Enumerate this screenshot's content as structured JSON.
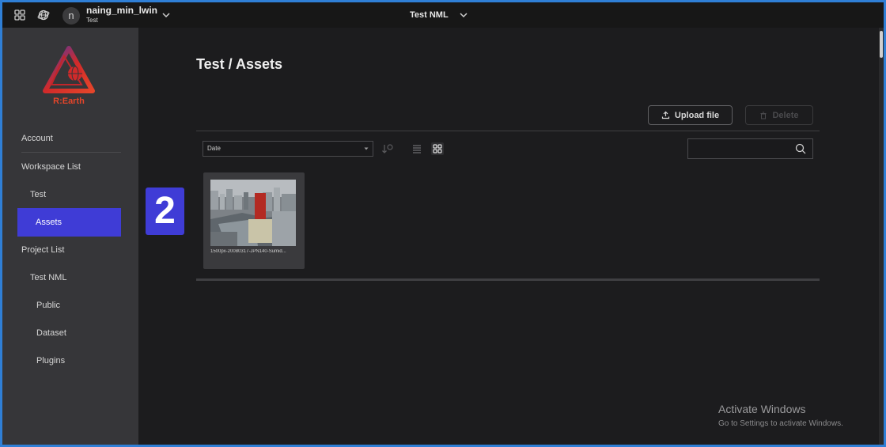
{
  "topbar": {
    "apps_icon": "apps-grid-icon",
    "globe_icon": "globe-icon",
    "avatar_initial": "n",
    "user_name": "naing_min_lwin",
    "workspace": "Test",
    "project_title": "Test NML"
  },
  "sidebar": {
    "logo_text": "R:Earth",
    "items": [
      {
        "label": "Account"
      },
      {
        "label": "Workspace List"
      },
      {
        "label": "Test"
      },
      {
        "label": "Assets"
      },
      {
        "label": "Project List"
      },
      {
        "label": "Test NML"
      },
      {
        "label": "Public"
      },
      {
        "label": "Dataset"
      },
      {
        "label": "Plugins"
      }
    ]
  },
  "main": {
    "title": "Test / Assets",
    "upload_label": "Upload file",
    "delete_label": "Delete",
    "sort_value": "Date",
    "search_placeholder": "",
    "assets": [
      {
        "name": "1500px-20080317-JPN140-Sumid..."
      }
    ],
    "badge_number": "2"
  },
  "overlay": {
    "activate_title": "Activate Windows",
    "activate_sub": "Go to Settings to activate Windows."
  },
  "colors": {
    "accent": "#3f3cd6",
    "topbar_bg": "#171717",
    "sidebar_bg": "#363639",
    "main_bg": "#1c1c1e",
    "frame_border": "#2f7fd6"
  }
}
